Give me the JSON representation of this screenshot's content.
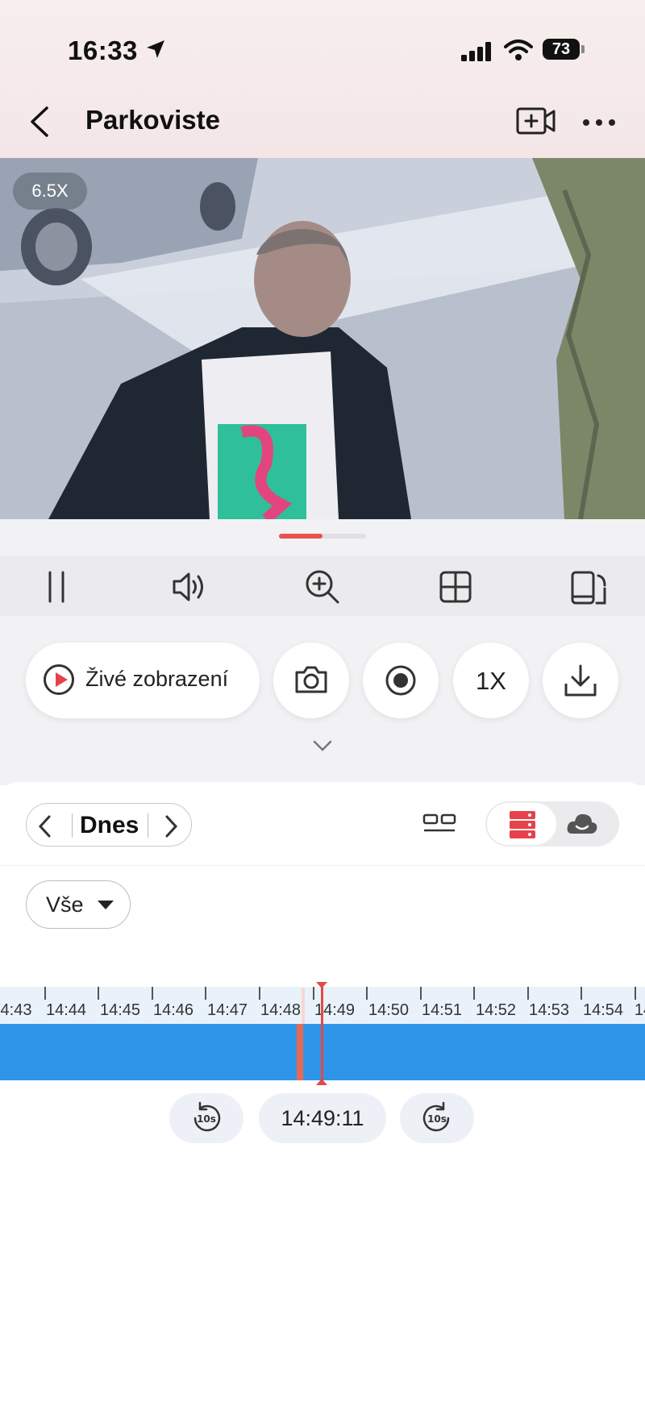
{
  "status_bar": {
    "time": "16:33",
    "battery": "73"
  },
  "header": {
    "title": "Parkoviste"
  },
  "video": {
    "zoom_level": "6.5X"
  },
  "controls": {
    "live_label": "Živé zobrazení",
    "speed_label": "1X"
  },
  "playback": {
    "date_label": "Dnes",
    "filter_label": "Vše",
    "timeline_labels": [
      "4:43",
      "14:44",
      "14:45",
      "14:46",
      "14:47",
      "14:48",
      "14:49",
      "14:50",
      "14:51",
      "14:52",
      "14:53",
      "14:54",
      "14"
    ],
    "current_time": "14:49:11"
  },
  "colors": {
    "accent": "#e8414a",
    "recording_bar": "#2f95e8"
  },
  "icons": [
    "back-icon",
    "camera-plus-icon",
    "more-icon",
    "pause-icon",
    "volume-icon",
    "zoom-in-icon",
    "grid-icon",
    "rotate-screen-icon",
    "play-icon",
    "snapshot-icon",
    "record-icon",
    "download-icon",
    "chevron-down-icon",
    "layout-icon",
    "server-icon",
    "cloud-icon",
    "rewind-10s-icon",
    "forward-10s-icon"
  ]
}
